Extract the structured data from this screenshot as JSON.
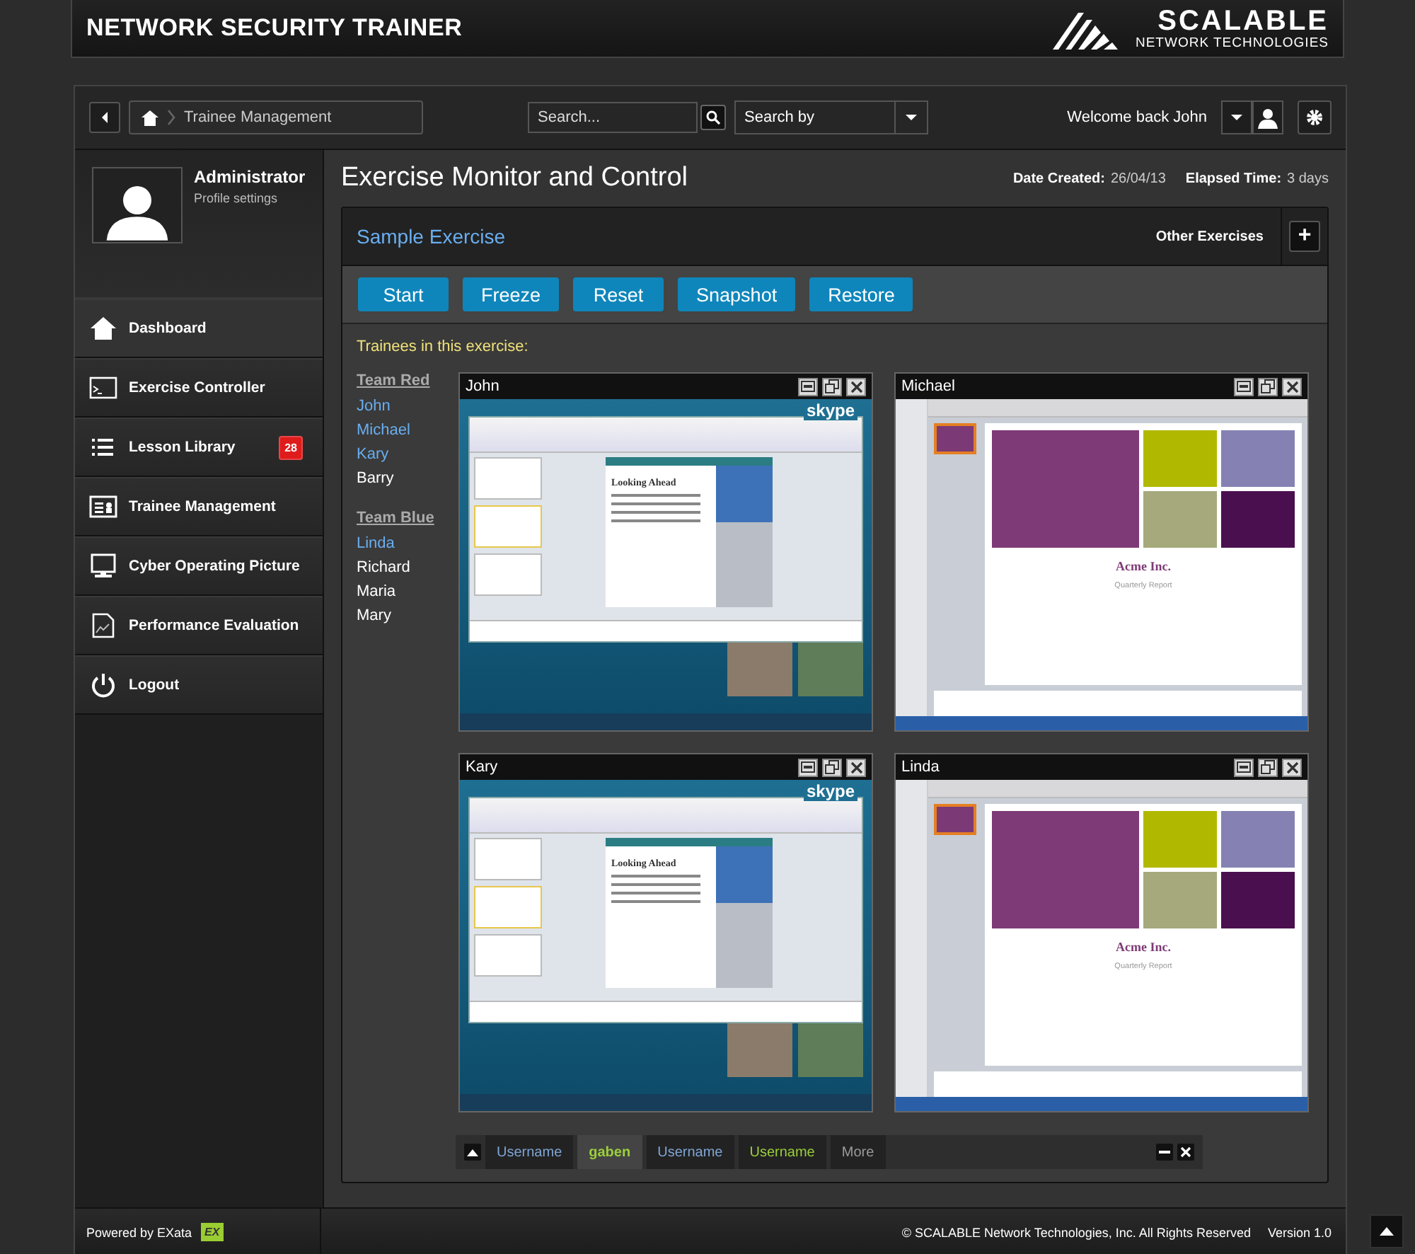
{
  "header": {
    "title": "NETWORK SECURITY TRAINER",
    "logo_name": "SCALABLE",
    "logo_sub": "NETWORK TECHNOLOGIES"
  },
  "toolbar": {
    "breadcrumb": "Trainee Management",
    "search": {
      "placeholder": "Search..."
    },
    "search_by": "Search by",
    "welcome": "Welcome back John"
  },
  "profile": {
    "name": "Administrator",
    "link": "Profile settings"
  },
  "sidebar": {
    "items": [
      {
        "kind": "home",
        "label": "Dashboard",
        "selected": true
      },
      {
        "kind": "terminal",
        "label": "Exercise Controller",
        "selected": false
      },
      {
        "kind": "list",
        "label": "Lesson Library",
        "selected": false,
        "badge": "28"
      },
      {
        "kind": "card",
        "label": "Trainee Management",
        "selected": false
      },
      {
        "kind": "monitor",
        "label": "Cyber Operating Picture",
        "selected": false
      },
      {
        "kind": "chart",
        "label": "Performance Evaluation",
        "selected": false
      },
      {
        "kind": "power",
        "label": "Logout",
        "selected": false
      }
    ]
  },
  "page": {
    "title": "Exercise Monitor and Control",
    "date_label": "Date Created:",
    "date": "26/04/13",
    "elapsed_label": "Elapsed Time:",
    "elapsed": "3 days"
  },
  "exercise": {
    "name": "Sample Exercise",
    "other": "Other Exercises",
    "add": "+",
    "buttons": [
      "Start",
      "Freeze",
      "Reset",
      "Snapshot",
      "Restore"
    ],
    "trainees_label": "Trainees in this exercise:"
  },
  "teams": [
    {
      "name": "Team Red",
      "members": [
        {
          "name": "John",
          "watched": true
        },
        {
          "name": "Michael",
          "watched": true
        },
        {
          "name": "Kary",
          "watched": true
        },
        {
          "name": "Barry",
          "watched": false
        }
      ]
    },
    {
      "name": "Team Blue",
      "members": [
        {
          "name": "Linda",
          "watched": true
        },
        {
          "name": "Richard",
          "watched": false
        },
        {
          "name": "Maria",
          "watched": false
        },
        {
          "name": "Mary",
          "watched": false
        }
      ]
    }
  ],
  "monitors": [
    {
      "name": "John",
      "screen": {
        "kind": "windows",
        "logo": "skype",
        "slide_title": "Looking Ahead"
      }
    },
    {
      "name": "Michael",
      "screen": {
        "kind": "mac",
        "slide_title": "Acme Inc.",
        "slide_subtitle": "Quarterly Report"
      }
    },
    {
      "name": "Kary",
      "screen": {
        "kind": "windows",
        "logo": "skype",
        "slide_title": "Looking Ahead"
      }
    },
    {
      "name": "Linda",
      "screen": {
        "kind": "mac",
        "slide_title": "Acme Inc.",
        "slide_subtitle": "Quarterly Report"
      }
    }
  ],
  "chat_bar": {
    "tabs": [
      {
        "label": "Username",
        "color": "#7fa6d6",
        "selected": false
      },
      {
        "label": "gaben",
        "color": "#9ccf3c",
        "selected": true
      },
      {
        "label": "Username",
        "color": "#7fa6d6",
        "selected": false
      },
      {
        "label": "Username",
        "color": "#9ccf3c",
        "selected": false
      },
      {
        "label": "More",
        "color": "#9a9a9a",
        "selected": false
      }
    ]
  },
  "footer": {
    "powered": "Powered by EXata",
    "badge": "EX",
    "copyright": "© SCALABLE Network Technologies, Inc. All Rights Reserved",
    "version": "Version 1.0"
  }
}
